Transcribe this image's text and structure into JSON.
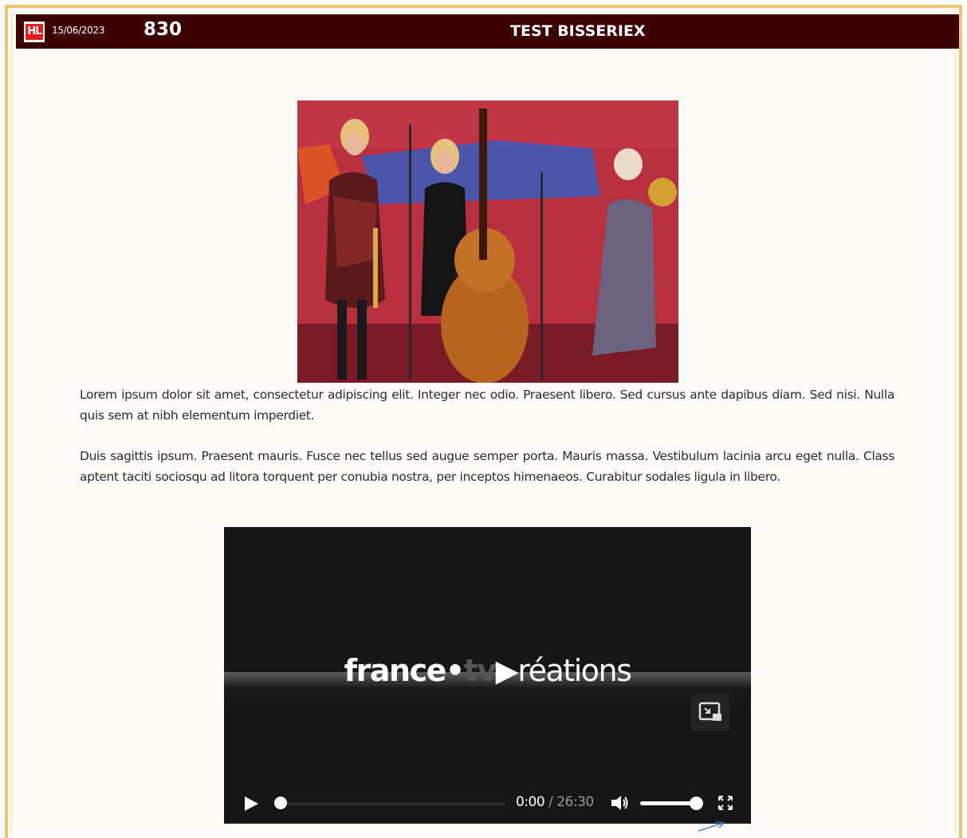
{
  "header": {
    "logo_text": "HL",
    "date": "15/06/2023",
    "number": "830",
    "title": "TEST BISSERIEX",
    "background": "#3d0000",
    "frame_color": "#f0c56c"
  },
  "article": {
    "image_alt": "Jazz band photo",
    "paragraphs": [
      "Lorem ipsum dolor sit amet, consectetur adipiscing elit. Integer nec odio. Praesent libero. Sed cursus ante dapibus diam. Sed nisi. Nulla quis sem at nibh elementum imperdiet.",
      "Duis sagittis ipsum. Praesent mauris. Fusce nec tellus sed augue semper porta. Mauris massa. Vestibulum lacinia arcu eget nulla. Class aptent taciti sociosqu ad litora torquent per conubia nostra, per inceptos himenaeos. Curabitur sodales ligula in libero."
    ]
  },
  "video": {
    "brand_left": "france",
    "brand_tv": "tv",
    "brand_right": "réations",
    "current_time": "0:00",
    "separator": " / ",
    "duration": "26:30",
    "progress": 0,
    "volume": 1.0,
    "icons": [
      "play-icon",
      "volume-icon",
      "fullscreen-icon",
      "picture-in-picture-icon"
    ]
  }
}
